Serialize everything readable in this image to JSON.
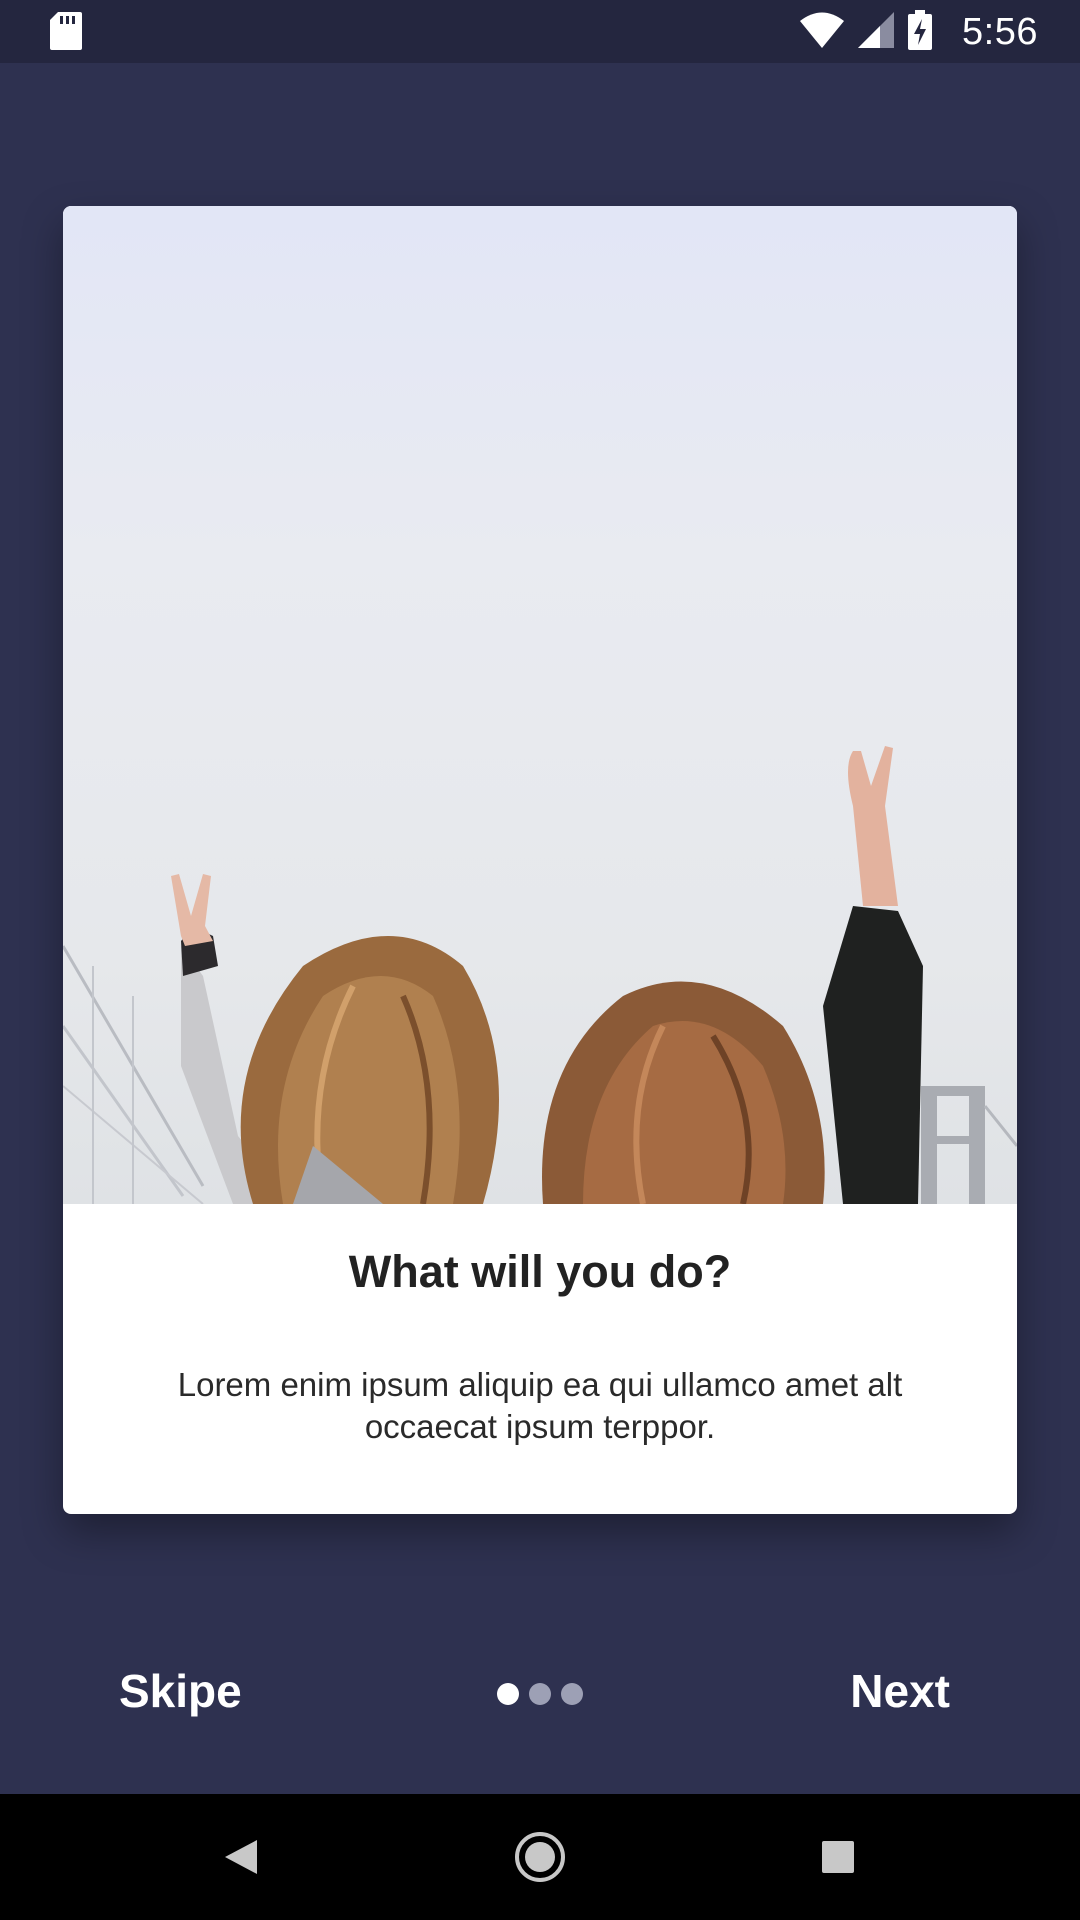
{
  "status_bar": {
    "time": "5:56",
    "icons": [
      "sd-card-icon",
      "wifi-icon",
      "signal-icon",
      "battery-charging-icon"
    ]
  },
  "card": {
    "image_alt": "Two women raising peace signs in front of a bridge",
    "title": "What will you do?",
    "body": "Lorem enim ipsum aliquip ea qui ullamco amet alt occaecat ipsum terppor."
  },
  "footer": {
    "skip_label": "Skipe",
    "next_label": "Next",
    "page_count": 3,
    "current_page": 1
  },
  "nav_bar": {
    "icons": [
      "back-icon",
      "home-icon",
      "recents-icon"
    ]
  },
  "colors": {
    "background": "#2e3150",
    "status_bar": "#24263f",
    "card": "#ffffff",
    "dot_active": "#ffffff",
    "dot_inactive": "#9da0b5"
  }
}
